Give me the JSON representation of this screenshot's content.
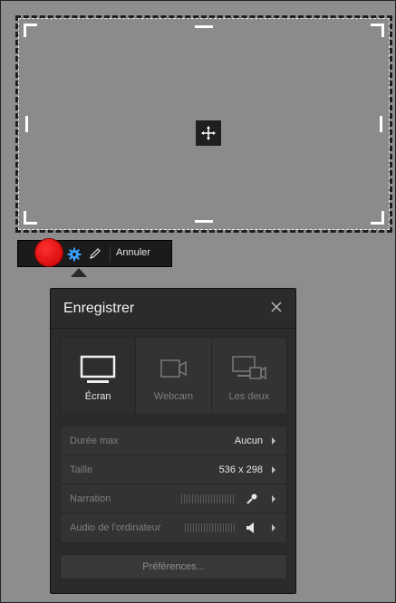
{
  "toolbar": {
    "cancel_label": "Annuler"
  },
  "dialog": {
    "title": "Enregistrer",
    "sources": [
      {
        "label": "Écran",
        "icon": "monitor-icon",
        "active": true
      },
      {
        "label": "Webcam",
        "icon": "webcam-icon",
        "active": false
      },
      {
        "label": "Les deux",
        "icon": "monitor-webcam-icon",
        "active": false
      }
    ],
    "settings": [
      {
        "label": "Durée max",
        "value": "Aucun"
      },
      {
        "label": "Taille",
        "value": "536 x 298"
      },
      {
        "label": "Narration",
        "value": ""
      },
      {
        "label": "Audio de l'ordinateur",
        "value": ""
      }
    ],
    "preferences_label": "Préférences..."
  },
  "colors": {
    "record": "#e00000",
    "accent_blue": "#3aa0ff",
    "panel": "#2b2b2b"
  }
}
